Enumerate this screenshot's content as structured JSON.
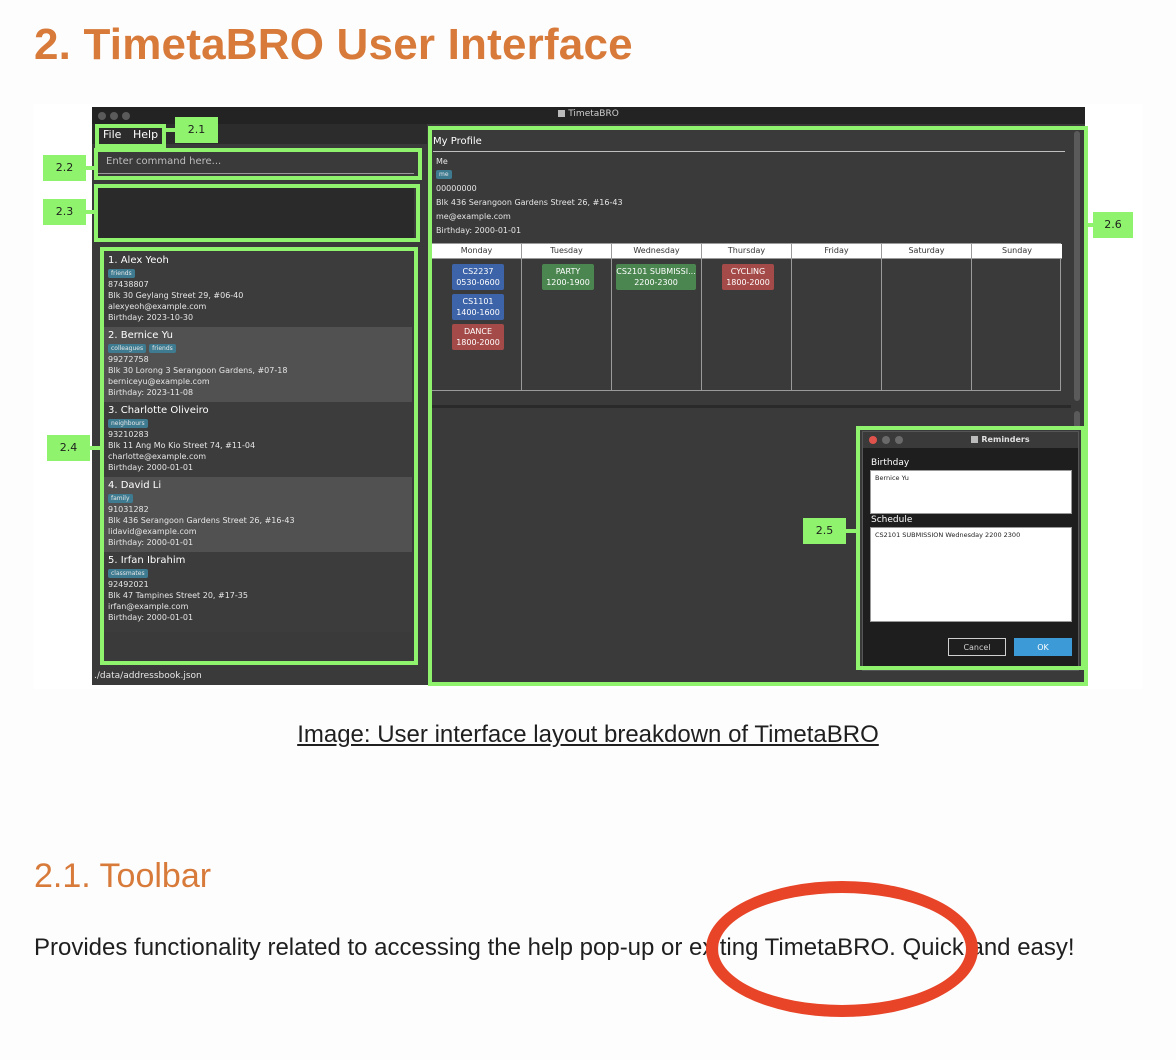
{
  "heading": "2. TimetaBRO User Interface",
  "figure": {
    "app_title": "TimetaBRO",
    "menu": [
      "File",
      "Help"
    ],
    "command_placeholder": "Enter command here...",
    "status_bar": "./data/addressbook.json",
    "persons": [
      {
        "name": "1.  Alex Yeoh",
        "tags": [
          "friends"
        ],
        "phone": "87438807",
        "address": "Blk 30 Geylang Street 29, #06-40",
        "email": "alexyeoh@example.com",
        "birthday": "Birthday: 2023-10-30"
      },
      {
        "name": "2.  Bernice Yu",
        "tags": [
          "colleagues",
          "friends"
        ],
        "phone": "99272758",
        "address": "Blk 30 Lorong 3 Serangoon Gardens, #07-18",
        "email": "berniceyu@example.com",
        "birthday": "Birthday: 2023-11-08"
      },
      {
        "name": "3.  Charlotte Oliveiro",
        "tags": [
          "neighbours"
        ],
        "phone": "93210283",
        "address": "Blk 11 Ang Mo Kio Street 74, #11-04",
        "email": "charlotte@example.com",
        "birthday": "Birthday: 2000-01-01"
      },
      {
        "name": "4.  David Li",
        "tags": [
          "family"
        ],
        "phone": "91031282",
        "address": "Blk 436 Serangoon Gardens Street 26, #16-43",
        "email": "lidavid@example.com",
        "birthday": "Birthday: 2000-01-01"
      },
      {
        "name": "5.  Irfan Ibrahim",
        "tags": [
          "classmates"
        ],
        "phone": "92492021",
        "address": "Blk 47 Tampines Street 20, #17-35",
        "email": "irfan@example.com",
        "birthday": "Birthday: 2000-01-01"
      }
    ],
    "profile": {
      "title": "My Profile",
      "name": "Me",
      "tag": "me",
      "phone": "00000000",
      "address": "Blk 436 Serangoon Gardens Street 26, #16-43",
      "email": "me@example.com",
      "birthday": "Birthday: 2000-01-01"
    },
    "days": [
      "Monday",
      "Tuesday",
      "Wednesday",
      "Thursday",
      "Friday",
      "Saturday",
      "Sunday"
    ],
    "events": [
      {
        "day": "Monday",
        "name": "CS2237",
        "time": "0530-0600",
        "color": "#3d63a8"
      },
      {
        "day": "Monday",
        "name": "CS1101",
        "time": "1400-1600",
        "color": "#3d63a8"
      },
      {
        "day": "Monday",
        "name": "DANCE",
        "time": "1800-2000",
        "color": "#a44a48"
      },
      {
        "day": "Tuesday",
        "name": "PARTY",
        "time": "1200-1900",
        "color": "#4b8650"
      },
      {
        "day": "Wednesday",
        "name": "CS2101 SUBMISSI...",
        "time": "2200-2300",
        "color": "#4b8650"
      },
      {
        "day": "Thursday",
        "name": "CYCLING",
        "time": "1800-2000",
        "color": "#a44a48"
      }
    ],
    "reminders": {
      "title": "Reminders",
      "birthday_label": "Birthday",
      "birthday_text": "Bernice Yu",
      "schedule_label": "Schedule",
      "schedule_text": "CS2101 SUBMISSION Wednesday 2200 2300",
      "cancel": "Cancel",
      "ok": "OK"
    },
    "callouts": [
      "2.1",
      "2.2",
      "2.3",
      "2.4",
      "2.5",
      "2.6"
    ],
    "highlight_color": "#8ff36e"
  },
  "caption": "Image: User interface layout breakdown of TimetaBRO",
  "subheading": "2.1. Toolbar",
  "paragraph": "Provides functionality related to accessing the help pop-up or exiting TimetaBRO. Quick and easy!",
  "annotation_color": "#e84427",
  "accent_color": "#d77a3a"
}
